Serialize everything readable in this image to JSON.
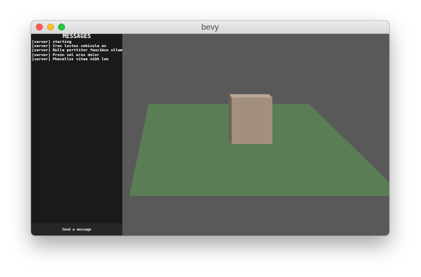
{
  "window": {
    "title": "bevy"
  },
  "sidebar": {
    "heading": "MESSAGES",
    "messages": [
      "[server] starting",
      "[server] Cras luctus vehicula ex",
      "[server] Nulla porttitor faucibus ullamcorper",
      "[server] Proin vel eros dolor",
      "[server] Phasellus vitae nibh leo"
    ],
    "compose_placeholder": "Send a message"
  },
  "scene": {
    "background_color": "#595959",
    "plane_color": "#5a7d55",
    "cube_front_color": "#a38f7e",
    "cube_top_color": "#b6a694",
    "cube_side_color": "#6e6053"
  }
}
